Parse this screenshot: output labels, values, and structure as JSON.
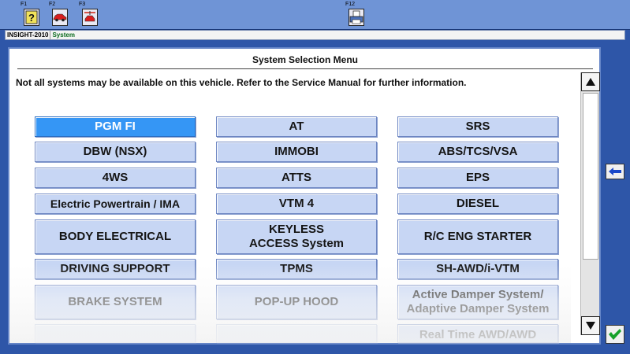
{
  "toolbar": {
    "keys": [
      {
        "label": "F1",
        "icon": "help-icon"
      },
      {
        "label": "F2",
        "icon": "car-icon"
      },
      {
        "label": "F3",
        "icon": "restart-icon"
      },
      {
        "label": "F12",
        "icon": "print-icon"
      }
    ]
  },
  "status": {
    "model": "INSIGHT-2010",
    "crumb": "System"
  },
  "panel": {
    "title": "System Selection Menu",
    "notice": "Not all systems may be available on this vehicle. Refer to the Service Manual for further information."
  },
  "systems": [
    [
      "PGM FI",
      "AT",
      "SRS"
    ],
    [
      "DBW (NSX)",
      "IMMOBI",
      "ABS/TCS/VSA"
    ],
    [
      "4WS",
      "ATTS",
      "EPS"
    ],
    [
      "Electric Powertrain / IMA",
      "VTM 4",
      "DIESEL"
    ],
    [
      "BODY ELECTRICAL",
      "KEYLESS ACCESS System",
      "R/C ENG STARTER"
    ],
    [
      "DRIVING SUPPORT",
      "TPMS",
      "SH-AWD/i-VTM"
    ],
    [
      "BRAKE SYSTEM",
      "POP-UP HOOD",
      "Active Damper System/ Adaptive Damper System"
    ],
    [
      "",
      "",
      "Real Time AWD/AWD"
    ]
  ],
  "selected": "PGM FI",
  "colors": {
    "selected": "#3596f5",
    "button": "#c7d6f4",
    "background": "#2e56a8",
    "toolbar": "#6f94d6"
  },
  "icons": {
    "scroll_up": "up-triangle-icon",
    "scroll_down": "down-triangle-icon",
    "back": "back-arrow-icon",
    "ok": "checkmark-icon"
  }
}
